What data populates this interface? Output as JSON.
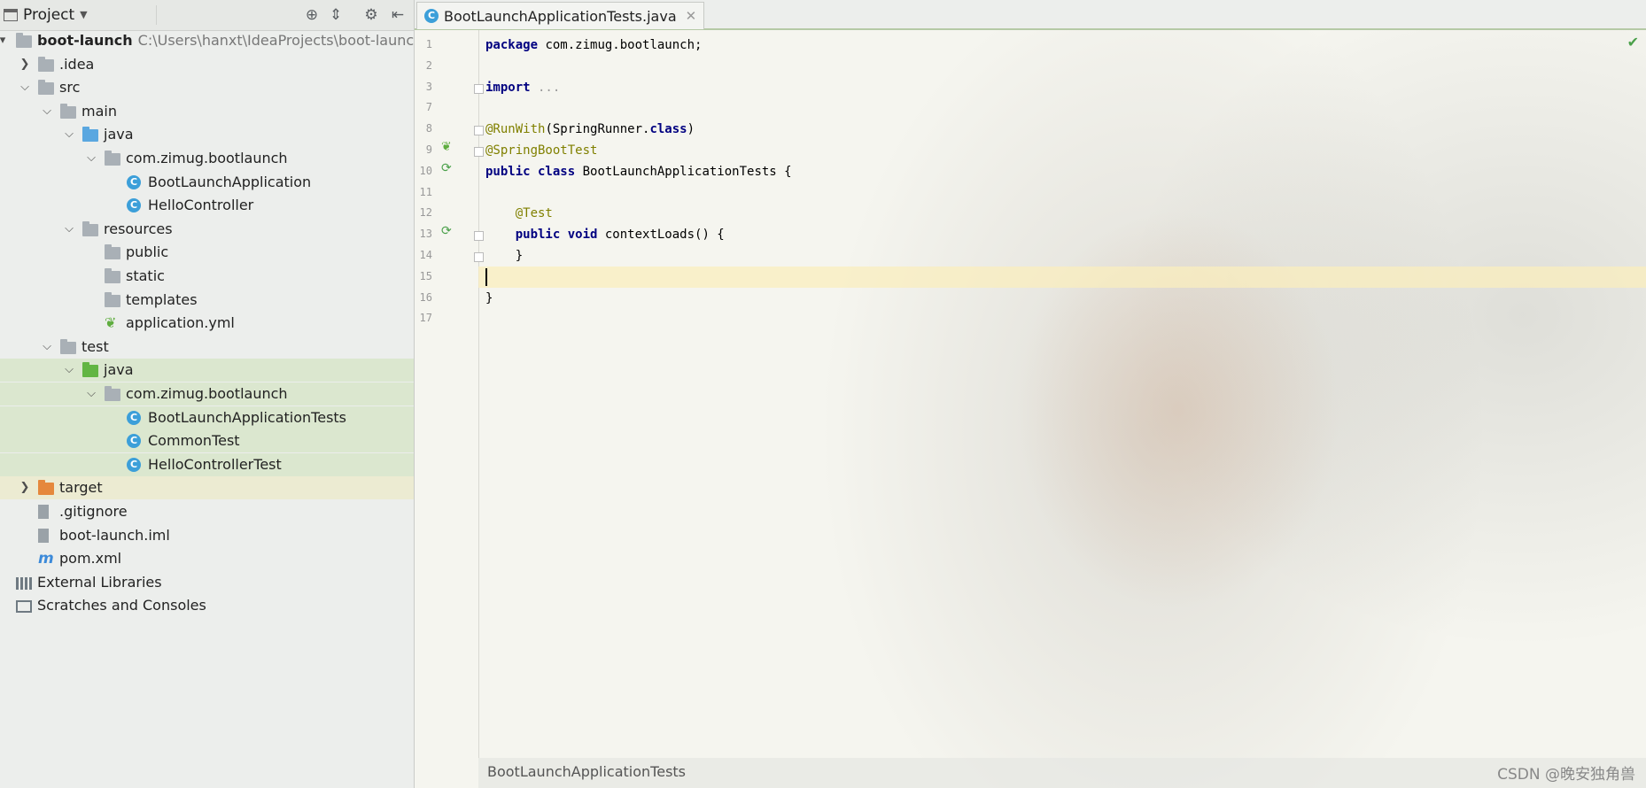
{
  "project_toolbar": {
    "title": "Project",
    "icons": [
      "locate-icon",
      "collapse-all-icon",
      "settings-icon",
      "hide-icon"
    ]
  },
  "tree": [
    {
      "label": "boot-launch",
      "path": "C:\\Users\\hanxt\\IdeaProjects\\boot-launch",
      "icon": "module-icon",
      "arrow": "▾",
      "bold": true
    },
    {
      "label": ".idea",
      "icon": "folder-icon",
      "arrow": "›"
    },
    {
      "label": "src",
      "icon": "folder-icon",
      "arrow": "⌄"
    },
    {
      "label": "main",
      "icon": "folder-icon",
      "arrow": "⌄"
    },
    {
      "label": "java",
      "icon": "source-folder-icon",
      "arrow": "⌄"
    },
    {
      "label": "com.zimug.bootlaunch",
      "icon": "package-icon",
      "arrow": "⌄"
    },
    {
      "label": "BootLaunchApplication",
      "icon": "spring-boot-class-icon",
      "arrow": ""
    },
    {
      "label": "HelloController",
      "icon": "class-icon",
      "arrow": ""
    },
    {
      "label": "resources",
      "icon": "resources-folder-icon",
      "arrow": "⌄"
    },
    {
      "label": "public",
      "icon": "folder-icon",
      "arrow": ""
    },
    {
      "label": "static",
      "icon": "folder-icon",
      "arrow": ""
    },
    {
      "label": "templates",
      "icon": "folder-icon",
      "arrow": ""
    },
    {
      "label": "application.yml",
      "icon": "spring-config-icon",
      "arrow": ""
    },
    {
      "label": "test",
      "icon": "folder-icon",
      "arrow": "⌄"
    },
    {
      "label": "java",
      "icon": "test-folder-icon",
      "arrow": "⌄"
    },
    {
      "label": "com.zimug.bootlaunch",
      "icon": "package-icon",
      "arrow": "⌄"
    },
    {
      "label": "BootLaunchApplicationTests",
      "icon": "class-icon",
      "arrow": ""
    },
    {
      "label": "CommonTest",
      "icon": "class-icon",
      "arrow": ""
    },
    {
      "label": "HelloControllerTest",
      "icon": "class-icon",
      "arrow": ""
    },
    {
      "label": "target",
      "icon": "excluded-folder-icon",
      "arrow": "›"
    },
    {
      "label": ".gitignore",
      "icon": "file-icon",
      "arrow": ""
    },
    {
      "label": "boot-launch.iml",
      "icon": "file-icon",
      "arrow": ""
    },
    {
      "label": "pom.xml",
      "icon": "maven-icon",
      "arrow": ""
    },
    {
      "label": "External Libraries",
      "icon": "libraries-icon",
      "arrow": ""
    },
    {
      "label": "Scratches and Consoles",
      "icon": "scratches-icon",
      "arrow": ""
    }
  ],
  "editor": {
    "tab_label": "BootLaunchApplicationTests.java",
    "line_numbers": [
      "1",
      "2",
      "3",
      "7",
      "8",
      "9",
      "10",
      "11",
      "12",
      "13",
      "14",
      "15",
      "16",
      "17"
    ],
    "lines": [
      [
        {
          "t": "package",
          "c": "kw"
        },
        {
          "t": " com.zimug.bootlaunch;",
          "c": ""
        }
      ],
      [],
      [
        {
          "t": "import",
          "c": "kw"
        },
        {
          "t": " ...",
          "c": "fold-text"
        }
      ],
      [],
      [
        {
          "t": "@RunWith",
          "c": "ann"
        },
        {
          "t": "(SpringRunner.",
          "c": ""
        },
        {
          "t": "class",
          "c": "kw"
        },
        {
          "t": ")",
          "c": ""
        }
      ],
      [
        {
          "t": "@SpringBootTest",
          "c": "ann"
        }
      ],
      [
        {
          "t": "public class",
          "c": "kw"
        },
        {
          "t": " BootLaunchApplicationTests {",
          "c": ""
        }
      ],
      [],
      [
        {
          "t": "    @Test",
          "c": "ann"
        }
      ],
      [
        {
          "t": "    public void",
          "c": "kw"
        },
        {
          "t": " contextLoads() {",
          "c": ""
        }
      ],
      [
        {
          "t": "    }",
          "c": ""
        }
      ],
      [],
      [
        {
          "t": "}",
          "c": ""
        }
      ],
      []
    ],
    "breadcrumb": "BootLaunchApplicationTests"
  },
  "watermark": "CSDN @晚安独角兽"
}
